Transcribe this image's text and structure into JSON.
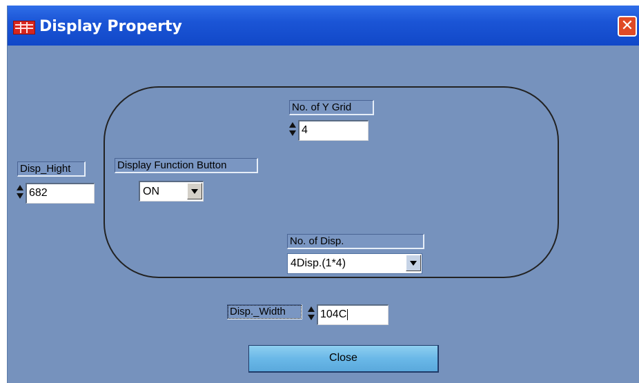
{
  "window": {
    "title": "Display Property"
  },
  "fields": {
    "y_grid": {
      "label": "No. of Y Grid",
      "value": "4"
    },
    "disp_hight": {
      "label": "Disp_Hight",
      "value": "682"
    },
    "function_button": {
      "label": "Display Function Button",
      "value": "ON"
    },
    "no_of_disp": {
      "label": "No. of  Disp.",
      "value": "4Disp.(1*4)"
    },
    "disp_width": {
      "label": "Disp._Width",
      "value": "104C"
    }
  },
  "buttons": {
    "close_label": "Close"
  },
  "colors": {
    "background": "#7692bd",
    "titlebar": "#1b55d6",
    "close_button": "#6ab8e8"
  }
}
